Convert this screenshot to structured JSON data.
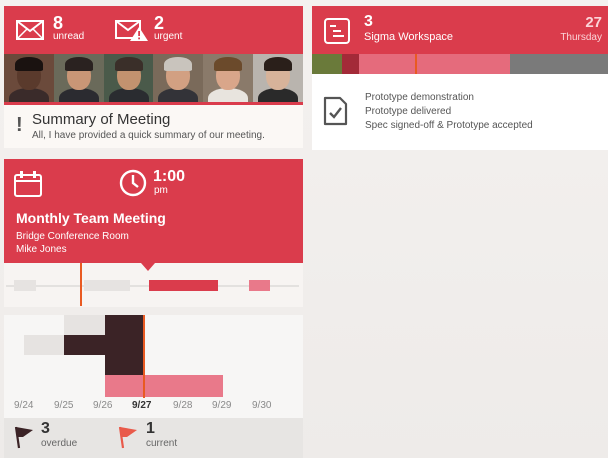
{
  "mail": {
    "unread_count": "8",
    "unread_label": "unread",
    "urgent_count": "2",
    "urgent_label": "urgent",
    "summary_title": "Summary of Meeting",
    "summary_body": "All, I have provided a quick summary of our meeting.",
    "icons": [
      "envelope-icon",
      "urgent-envelope-icon",
      "exclamation-icon"
    ],
    "photos": [
      {
        "skin": "#5a3a2c",
        "hair": "#1a1210",
        "clothes": "#3a2b2a",
        "bg": "#6b4a3b"
      },
      {
        "skin": "#c99676",
        "hair": "#2a2220",
        "clothes": "#2b2b30",
        "bg": "#6a6a5a"
      },
      {
        "skin": "#c2926f",
        "hair": "#3a2f29",
        "clothes": "#2a2c30",
        "bg": "#4a5a4a"
      },
      {
        "skin": "#d2a082",
        "hair": "#c9c4bd",
        "clothes": "#333338",
        "bg": "#7a6a5a"
      },
      {
        "skin": "#d9a68a",
        "hair": "#6b4a2b",
        "clothes": "#e8e4de",
        "bg": "#8a7a6a"
      },
      {
        "skin": "#d7b39a",
        "hair": "#2a1f1a",
        "clothes": "#2a2a2a",
        "bg": "#b9b4ae"
      }
    ]
  },
  "workspace": {
    "count": "3",
    "name": "Sigma Workspace",
    "day": "27",
    "dayname": "Thursday",
    "items": [
      "Prototype demonstration",
      "Prototype delivered",
      "Spec signed-off & Prototype accepted"
    ],
    "progress_segments": [
      {
        "color": "#6a7a3a",
        "fraction": 0.1
      },
      {
        "color": "#a32a38",
        "fraction": 0.06
      },
      {
        "color": "#e56b7c",
        "fraction": 0.51
      },
      {
        "color": "#7a7a7a",
        "fraction": 0.33
      }
    ],
    "icons": [
      "document-icon",
      "checklist-icon"
    ]
  },
  "meeting": {
    "time": "1:00",
    "ampm": "pm",
    "title": "Monthly Team Meeting",
    "location": "Bridge Conference Room",
    "organizer": "Mike Jones",
    "icons": [
      "calendar-icon",
      "clock-icon"
    ]
  },
  "tasks": {
    "dates": [
      "9/24",
      "9/25",
      "9/26",
      "9/27",
      "9/28",
      "9/29",
      "9/30"
    ],
    "today_index": 3,
    "overdue_count": "3",
    "overdue_label": "overdue",
    "current_count": "1",
    "current_label": "current",
    "icons": [
      "dark-flag-icon",
      "red-flag-icon"
    ]
  },
  "colors": {
    "accent": "#da3c4c",
    "now_marker": "#e95a22",
    "dark_block": "#3b2326",
    "light_block": "#e6e3e1",
    "pink_block": "#e9798a"
  }
}
